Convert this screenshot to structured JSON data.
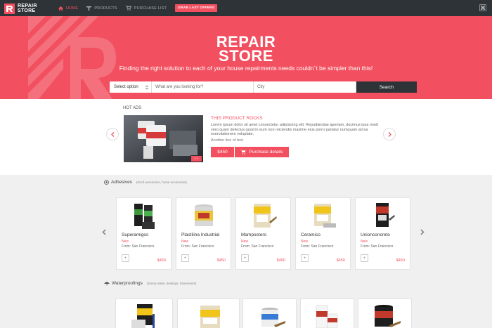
{
  "nav": {
    "logo_line1": "REPAIR",
    "logo_line2": "STORE",
    "items": [
      {
        "label": "HOME",
        "icon": "home-icon",
        "active": true
      },
      {
        "label": "PRODUCTS",
        "icon": "wrench-icon",
        "active": false
      },
      {
        "label": "PURCHASE LIST",
        "icon": "cart-icon",
        "active": false
      }
    ],
    "grab_label": "GRAB LAST OFFERS"
  },
  "hero": {
    "title_line1": "REPAIR",
    "title_line2": "STORE",
    "subtitle": "Finding the right solution to each of your house repairments needs couldn´t be simpler than this!",
    "select_label": "Select option",
    "query_placeholder": "What are you looking for?",
    "city_placeholder": "City",
    "search_label": "Search"
  },
  "hot_ads": {
    "heading": "HOT ADS",
    "ad_title": "THIS PRODUCT ROCKS",
    "ad_desc": "Lorem ipsum dolor sit amet consectetur adipisicing elit. Repudiandae aperiam, ducimus ipsa modi vero quam delectus quod in eum non reiciendis maxime eius porro pariatur numquam ad ea exercitationem voluptate.",
    "ad_line": "Another line of text",
    "price": "$450",
    "buy_label": "Purchase details"
  },
  "adhesives": {
    "heading": "Adhesives",
    "sub": "(Roof accesories, home accesories)",
    "products": [
      {
        "name": "Superamigos",
        "badge": "New",
        "from": "From: San Francisco",
        "price": "$450"
      },
      {
        "name": "Plastilina Industrial",
        "badge": "New",
        "from": "From: San Francisco",
        "price": "$450"
      },
      {
        "name": "Mampostero",
        "badge": "New",
        "from": "From: San Francisco",
        "price": "$450"
      },
      {
        "name": "Ceramico",
        "badge": "New",
        "from": "From: San Francisco",
        "price": "$450"
      },
      {
        "name": "Unionconcreto",
        "badge": "New",
        "from": "From: San Francisco",
        "price": "$450"
      }
    ],
    "add_symbol": "+"
  },
  "waterproofings": {
    "heading": "Waterproofings",
    "sub": "(Dump water, leakings, basements)"
  },
  "colors": {
    "accent": "#f25060",
    "dark": "#2e3338"
  }
}
